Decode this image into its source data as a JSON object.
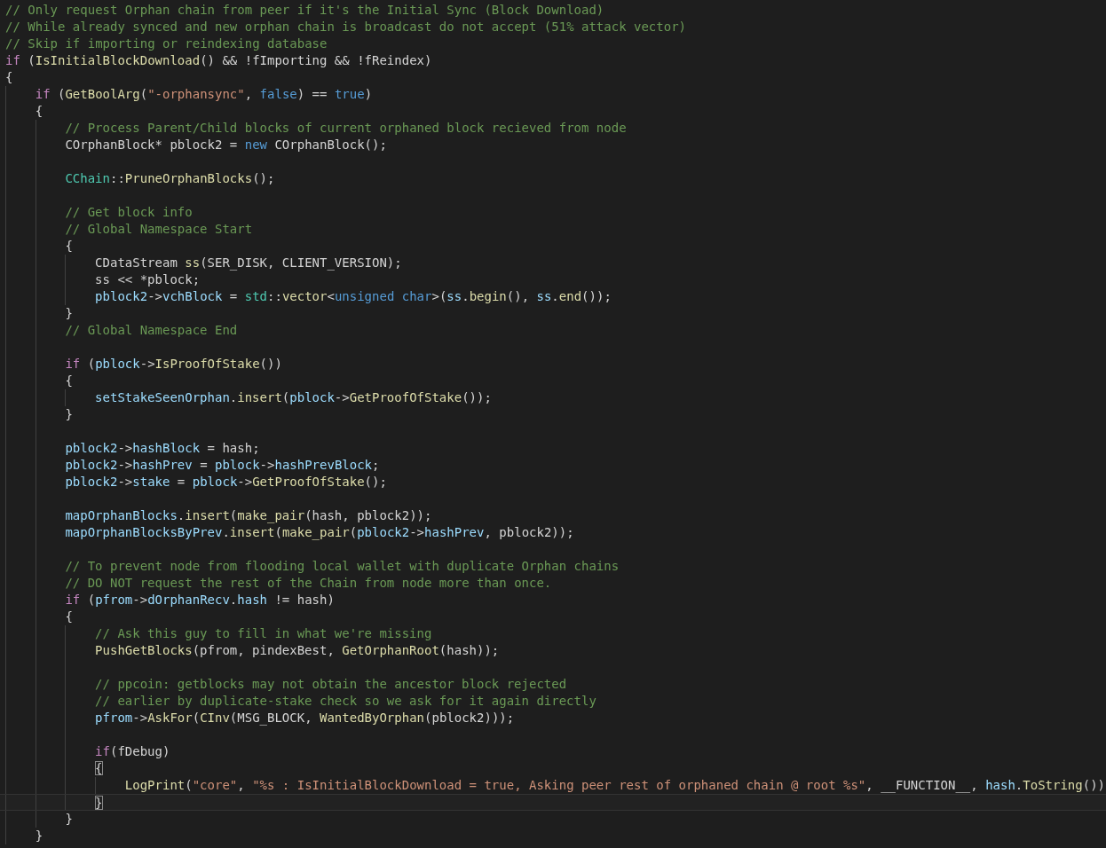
{
  "editor": {
    "lines": [
      {
        "current": false,
        "tokens": [
          {
            "kind": "comment",
            "text": "// Only request Orphan chain from peer if it's the Initial Sync (Block Download)"
          }
        ]
      },
      {
        "current": false,
        "tokens": [
          {
            "kind": "comment",
            "text": "// While already synced and new orphan chain is broadcast do not accept (51% attack vector)"
          }
        ]
      },
      {
        "current": false,
        "tokens": [
          {
            "kind": "comment",
            "text": "// Skip if importing or reindexing database"
          }
        ]
      },
      {
        "current": false,
        "tokens": [
          {
            "kind": "control",
            "text": "if"
          },
          {
            "kind": "plain",
            "text": " ("
          },
          {
            "kind": "function",
            "text": "IsInitialBlockDownload"
          },
          {
            "kind": "plain",
            "text": "() && !fImporting && !fReindex)"
          }
        ]
      },
      {
        "current": false,
        "tokens": [
          {
            "kind": "plain",
            "text": "{"
          }
        ]
      },
      {
        "current": false,
        "tokens": [
          {
            "kind": "control",
            "text": "    if"
          },
          {
            "kind": "plain",
            "text": " ("
          },
          {
            "kind": "function",
            "text": "GetBoolArg"
          },
          {
            "kind": "plain",
            "text": "("
          },
          {
            "kind": "string",
            "text": "\"-orphansync\""
          },
          {
            "kind": "plain",
            "text": ", "
          },
          {
            "kind": "literal",
            "text": "false"
          },
          {
            "kind": "plain",
            "text": ") == "
          },
          {
            "kind": "literal",
            "text": "true"
          },
          {
            "kind": "plain",
            "text": ")"
          }
        ]
      },
      {
        "current": false,
        "tokens": [
          {
            "kind": "plain",
            "text": "    {"
          }
        ]
      },
      {
        "current": false,
        "tokens": [
          {
            "kind": "comment",
            "text": "        // Process Parent/Child blocks of current orphaned block recieved from node"
          }
        ]
      },
      {
        "current": false,
        "tokens": [
          {
            "kind": "plain",
            "text": "        COrphanBlock* pblock2 = "
          },
          {
            "kind": "literal",
            "text": "new"
          },
          {
            "kind": "plain",
            "text": " COrphanBlock();"
          }
        ]
      },
      {
        "current": false
      },
      {
        "current": false,
        "tokens": [
          {
            "kind": "type",
            "text": "        CChain"
          },
          {
            "kind": "plain",
            "text": "::"
          },
          {
            "kind": "function",
            "text": "PruneOrphanBlocks"
          },
          {
            "kind": "plain",
            "text": "();"
          }
        ]
      },
      {
        "current": false
      },
      {
        "current": false,
        "tokens": [
          {
            "kind": "comment",
            "text": "        // Get block info"
          }
        ]
      },
      {
        "current": false,
        "tokens": [
          {
            "kind": "comment",
            "text": "        // Global Namespace Start"
          }
        ]
      },
      {
        "current": false,
        "tokens": [
          {
            "kind": "plain",
            "text": "        {"
          }
        ]
      },
      {
        "current": false,
        "tokens": [
          {
            "kind": "plain",
            "text": "            CDataStream "
          },
          {
            "kind": "function",
            "text": "ss"
          },
          {
            "kind": "plain",
            "text": "(SER_DISK, CLIENT_VERSION);"
          }
        ]
      },
      {
        "current": false,
        "tokens": [
          {
            "kind": "plain",
            "text": "            ss << *pblock;"
          }
        ]
      },
      {
        "current": false,
        "tokens": [
          {
            "kind": "variable",
            "text": "            pblock2"
          },
          {
            "kind": "plain",
            "text": "->"
          },
          {
            "kind": "variable",
            "text": "vchBlock"
          },
          {
            "kind": "plain",
            "text": " = "
          },
          {
            "kind": "type",
            "text": "std"
          },
          {
            "kind": "plain",
            "text": "::"
          },
          {
            "kind": "function",
            "text": "vector"
          },
          {
            "kind": "plain",
            "text": "<"
          },
          {
            "kind": "literal",
            "text": "unsigned char"
          },
          {
            "kind": "plain",
            "text": ">("
          },
          {
            "kind": "variable",
            "text": "ss"
          },
          {
            "kind": "plain",
            "text": "."
          },
          {
            "kind": "function",
            "text": "begin"
          },
          {
            "kind": "plain",
            "text": "(), "
          },
          {
            "kind": "variable",
            "text": "ss"
          },
          {
            "kind": "plain",
            "text": "."
          },
          {
            "kind": "function",
            "text": "end"
          },
          {
            "kind": "plain",
            "text": "());"
          }
        ]
      },
      {
        "current": false,
        "tokens": [
          {
            "kind": "plain",
            "text": "        }"
          }
        ]
      },
      {
        "current": false,
        "tokens": [
          {
            "kind": "comment",
            "text": "        // Global Namespace End"
          }
        ]
      },
      {
        "current": false
      },
      {
        "current": false,
        "tokens": [
          {
            "kind": "control",
            "text": "        if"
          },
          {
            "kind": "plain",
            "text": " ("
          },
          {
            "kind": "variable",
            "text": "pblock"
          },
          {
            "kind": "plain",
            "text": "->"
          },
          {
            "kind": "function",
            "text": "IsProofOfStake"
          },
          {
            "kind": "plain",
            "text": "())"
          }
        ]
      },
      {
        "current": false,
        "tokens": [
          {
            "kind": "plain",
            "text": "        {"
          }
        ]
      },
      {
        "current": false,
        "tokens": [
          {
            "kind": "variable",
            "text": "            setStakeSeenOrphan"
          },
          {
            "kind": "plain",
            "text": "."
          },
          {
            "kind": "function",
            "text": "insert"
          },
          {
            "kind": "plain",
            "text": "("
          },
          {
            "kind": "variable",
            "text": "pblock"
          },
          {
            "kind": "plain",
            "text": "->"
          },
          {
            "kind": "function",
            "text": "GetProofOfStake"
          },
          {
            "kind": "plain",
            "text": "());"
          }
        ]
      },
      {
        "current": false,
        "tokens": [
          {
            "kind": "plain",
            "text": "        }"
          }
        ]
      },
      {
        "current": false
      },
      {
        "current": false,
        "tokens": [
          {
            "kind": "variable",
            "text": "        pblock2"
          },
          {
            "kind": "plain",
            "text": "->"
          },
          {
            "kind": "variable",
            "text": "hashBlock"
          },
          {
            "kind": "plain",
            "text": " = hash;"
          }
        ]
      },
      {
        "current": false,
        "tokens": [
          {
            "kind": "variable",
            "text": "        pblock2"
          },
          {
            "kind": "plain",
            "text": "->"
          },
          {
            "kind": "variable",
            "text": "hashPrev"
          },
          {
            "kind": "plain",
            "text": " = "
          },
          {
            "kind": "variable",
            "text": "pblock"
          },
          {
            "kind": "plain",
            "text": "->"
          },
          {
            "kind": "variable",
            "text": "hashPrevBlock"
          },
          {
            "kind": "plain",
            "text": ";"
          }
        ]
      },
      {
        "current": false,
        "tokens": [
          {
            "kind": "variable",
            "text": "        pblock2"
          },
          {
            "kind": "plain",
            "text": "->"
          },
          {
            "kind": "variable",
            "text": "stake"
          },
          {
            "kind": "plain",
            "text": " = "
          },
          {
            "kind": "variable",
            "text": "pblock"
          },
          {
            "kind": "plain",
            "text": "->"
          },
          {
            "kind": "function",
            "text": "GetProofOfStake"
          },
          {
            "kind": "plain",
            "text": "();"
          }
        ]
      },
      {
        "current": false
      },
      {
        "current": false,
        "tokens": [
          {
            "kind": "variable",
            "text": "        mapOrphanBlocks"
          },
          {
            "kind": "plain",
            "text": "."
          },
          {
            "kind": "function",
            "text": "insert"
          },
          {
            "kind": "plain",
            "text": "("
          },
          {
            "kind": "function",
            "text": "make_pair"
          },
          {
            "kind": "plain",
            "text": "(hash, pblock2));"
          }
        ]
      },
      {
        "current": false,
        "tokens": [
          {
            "kind": "variable",
            "text": "        mapOrphanBlocksByPrev"
          },
          {
            "kind": "plain",
            "text": "."
          },
          {
            "kind": "function",
            "text": "insert"
          },
          {
            "kind": "plain",
            "text": "("
          },
          {
            "kind": "function",
            "text": "make_pair"
          },
          {
            "kind": "plain",
            "text": "("
          },
          {
            "kind": "variable",
            "text": "pblock2"
          },
          {
            "kind": "plain",
            "text": "->"
          },
          {
            "kind": "variable",
            "text": "hashPrev"
          },
          {
            "kind": "plain",
            "text": ", pblock2));"
          }
        ]
      },
      {
        "current": false
      },
      {
        "current": false,
        "tokens": [
          {
            "kind": "comment",
            "text": "        // To prevent node from flooding local wallet with duplicate Orphan chains"
          }
        ]
      },
      {
        "current": false,
        "tokens": [
          {
            "kind": "comment",
            "text": "        // DO NOT request the rest of the Chain from node more than once."
          }
        ]
      },
      {
        "current": false,
        "tokens": [
          {
            "kind": "control",
            "text": "        if"
          },
          {
            "kind": "plain",
            "text": " ("
          },
          {
            "kind": "variable",
            "text": "pfrom"
          },
          {
            "kind": "plain",
            "text": "->"
          },
          {
            "kind": "variable",
            "text": "dOrphanRecv"
          },
          {
            "kind": "plain",
            "text": "."
          },
          {
            "kind": "variable",
            "text": "hash"
          },
          {
            "kind": "plain",
            "text": " != hash)"
          }
        ]
      },
      {
        "current": false,
        "tokens": [
          {
            "kind": "plain",
            "text": "        {"
          }
        ]
      },
      {
        "current": false,
        "tokens": [
          {
            "kind": "comment",
            "text": "            // Ask this guy to fill in what we're missing"
          }
        ]
      },
      {
        "current": false,
        "tokens": [
          {
            "kind": "function",
            "text": "            PushGetBlocks"
          },
          {
            "kind": "plain",
            "text": "(pfrom, pindexBest, "
          },
          {
            "kind": "function",
            "text": "GetOrphanRoot"
          },
          {
            "kind": "plain",
            "text": "(hash));"
          }
        ]
      },
      {
        "current": false
      },
      {
        "current": false,
        "tokens": [
          {
            "kind": "comment",
            "text": "            // ppcoin: getblocks may not obtain the ancestor block rejected"
          }
        ]
      },
      {
        "current": false,
        "tokens": [
          {
            "kind": "comment",
            "text": "            // earlier by duplicate-stake check so we ask for it again directly"
          }
        ]
      },
      {
        "current": false,
        "tokens": [
          {
            "kind": "variable",
            "text": "            pfrom"
          },
          {
            "kind": "plain",
            "text": "->"
          },
          {
            "kind": "function",
            "text": "AskFor"
          },
          {
            "kind": "plain",
            "text": "("
          },
          {
            "kind": "function",
            "text": "CInv"
          },
          {
            "kind": "plain",
            "text": "(MSG_BLOCK, "
          },
          {
            "kind": "function",
            "text": "WantedByOrphan"
          },
          {
            "kind": "plain",
            "text": "(pblock2)));"
          }
        ]
      },
      {
        "current": false
      },
      {
        "current": false,
        "tokens": [
          {
            "kind": "control",
            "text": "            if"
          },
          {
            "kind": "plain",
            "text": "(fDebug)"
          }
        ]
      },
      {
        "current": false,
        "tokens": [
          {
            "kind": "match",
            "text": "            {"
          }
        ]
      },
      {
        "current": false,
        "tokens": [
          {
            "kind": "function",
            "text": "                LogPrint"
          },
          {
            "kind": "plain",
            "text": "("
          },
          {
            "kind": "string",
            "text": "\"core\""
          },
          {
            "kind": "plain",
            "text": ", "
          },
          {
            "kind": "string",
            "text": "\"%s : IsInitialBlockDownload = true, Asking peer rest of orphaned chain @ root %s\""
          },
          {
            "kind": "plain",
            "text": ", __FUNCTION__, "
          },
          {
            "kind": "variable",
            "text": "hash"
          },
          {
            "kind": "plain",
            "text": "."
          },
          {
            "kind": "function",
            "text": "ToString"
          },
          {
            "kind": "plain",
            "text": "())"
          }
        ]
      },
      {
        "current": true,
        "tokens": [
          {
            "kind": "match",
            "text": "            }"
          }
        ]
      },
      {
        "current": false,
        "tokens": [
          {
            "kind": "plain",
            "text": "        }"
          }
        ]
      },
      {
        "current": false,
        "tokens": [
          {
            "kind": "plain",
            "text": "    }"
          }
        ]
      }
    ]
  }
}
